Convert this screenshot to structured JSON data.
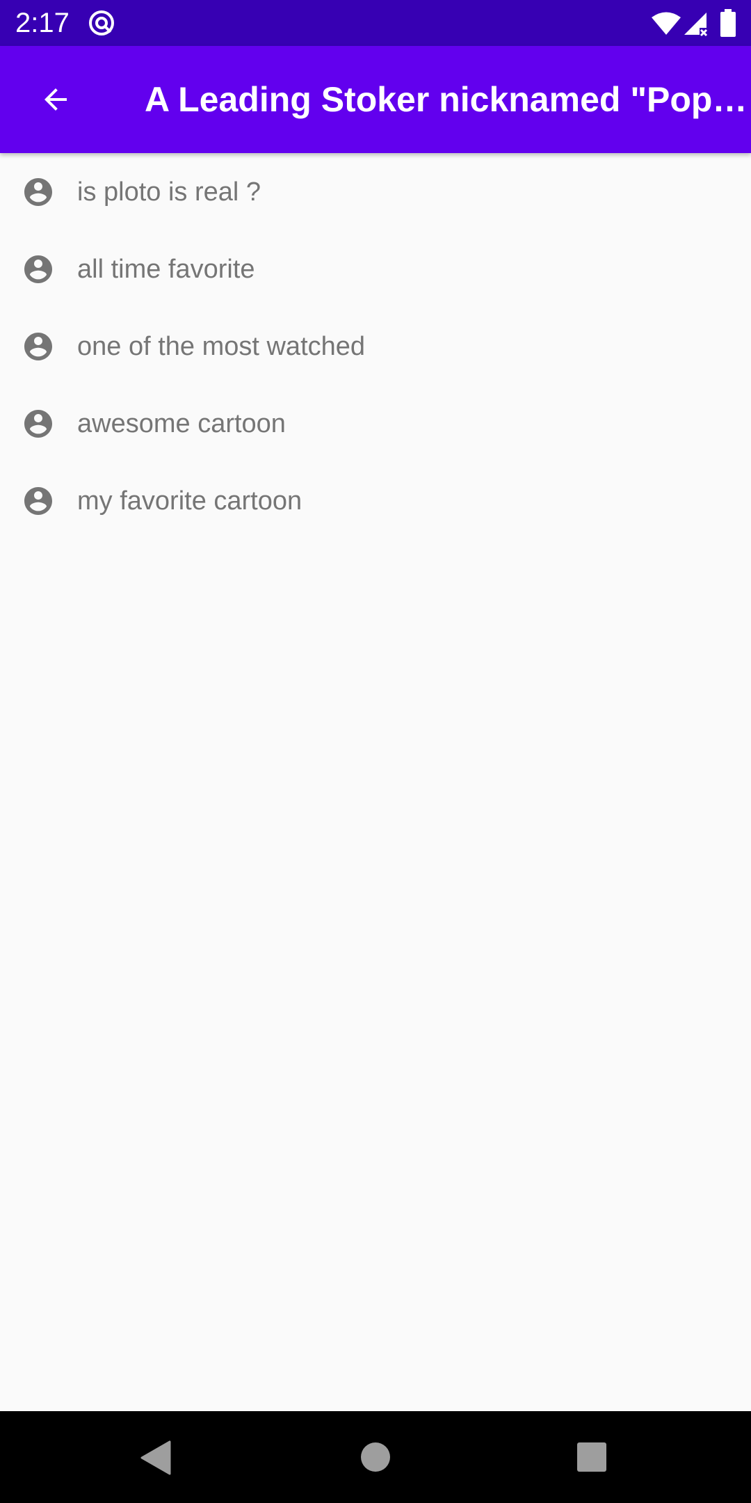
{
  "status_bar": {
    "time": "2:17",
    "icons": [
      "app-notification-icon",
      "wifi-icon",
      "signal-icon",
      "battery-icon"
    ]
  },
  "app_bar": {
    "title": "A Leading Stoker nicknamed \"Pop…",
    "back_icon": "arrow-back-icon",
    "color": "#6200ee"
  },
  "comments": [
    {
      "text": "is ploto is real ?",
      "icon": "account-circle-icon"
    },
    {
      "text": "all time favorite",
      "icon": "account-circle-icon"
    },
    {
      "text": "one of the most watched",
      "icon": "account-circle-icon"
    },
    {
      "text": "awesome cartoon",
      "icon": "account-circle-icon"
    },
    {
      "text": "my favorite cartoon",
      "icon": "account-circle-icon"
    }
  ],
  "nav_bar": {
    "icons": [
      "nav-back-icon",
      "nav-home-icon",
      "nav-recents-icon"
    ]
  },
  "colors": {
    "status_bar": "#3700b3",
    "app_bar": "#6200ee",
    "background": "#fafafa",
    "text": "#757575"
  }
}
